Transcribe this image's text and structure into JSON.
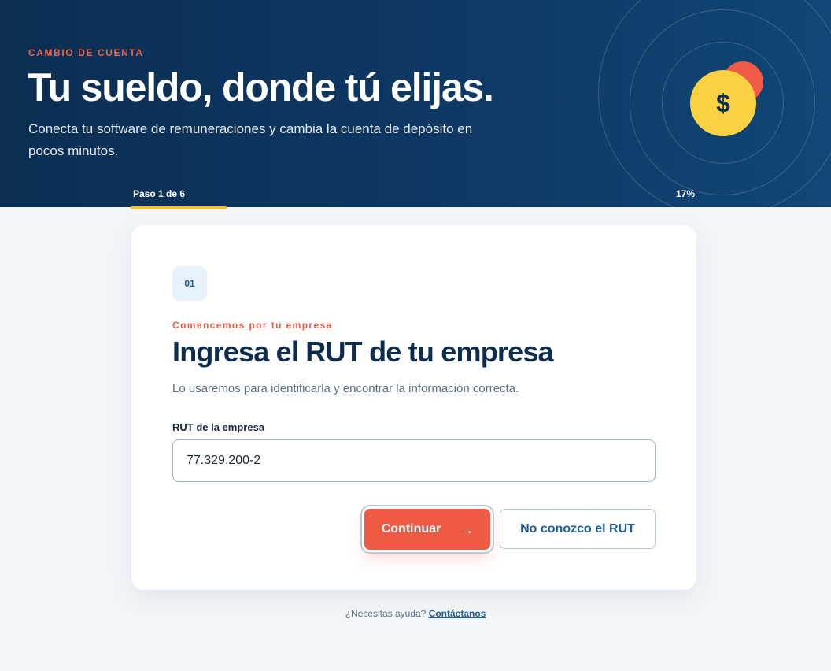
{
  "hero": {
    "eyebrow": "CAMBIO DE CUENTA",
    "title": "Tu sueldo, donde tú elijas.",
    "subtitle": "Conecta tu software de remuneraciones y cambia la cuenta de depósito en pocos minutos.",
    "coin_symbol": "$",
    "colors": {
      "background": "#0e3a66",
      "accent": "#f06449",
      "coin": "#fbd144",
      "coin_back": "#ef5b44"
    }
  },
  "progress": {
    "step_label": "Paso 1 de 6",
    "percent_label": "17%",
    "fraction": 0.17,
    "color": "#f5c12e"
  },
  "card": {
    "step_number": "01",
    "eyebrow": "Comencemos por tu empresa",
    "title": "Ingresa el RUT de tu empresa",
    "description": "Lo usaremos para identificarla y encontrar la información correcta.",
    "field": {
      "label": "RUT de la empresa",
      "value": "77.329.200-2"
    },
    "primary_button": {
      "label": "Continuar",
      "icon": "arrow-right-icon",
      "icon_glyph": "→",
      "color": "#ef5a45"
    },
    "secondary_button": {
      "label": "No conozco el RUT"
    }
  },
  "help": {
    "text": "¿Necesitas ayuda?",
    "link": "Contáctanos"
  }
}
